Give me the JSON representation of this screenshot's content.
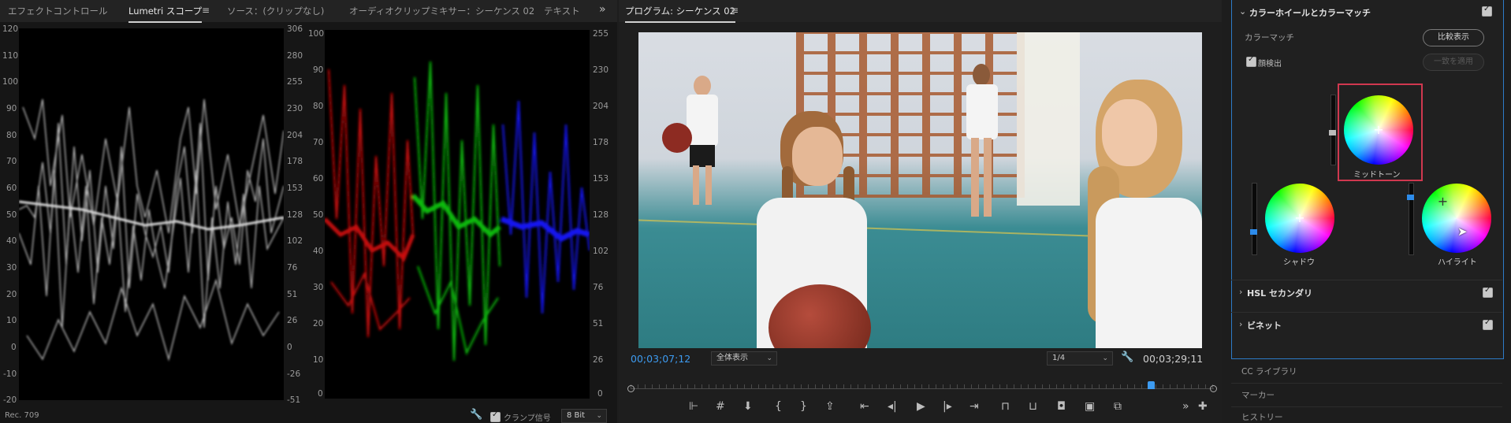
{
  "left_panel": {
    "tabs": [
      "エフェクトコントロール",
      "Lumetri スコープ",
      "ソース：(クリップなし)",
      "オーディオクリップミキサー：シーケンス 02",
      "テキスト"
    ],
    "active_tab": "Lumetri スコープ",
    "waveform": {
      "left_axis": [
        "120",
        "110",
        "100",
        "90",
        "80",
        "70",
        "60",
        "50",
        "40",
        "30",
        "20",
        "10",
        "0",
        "-10",
        "-20"
      ],
      "right_axis": [
        "306",
        "280",
        "255",
        "230",
        "204",
        "178",
        "153",
        "128",
        "102",
        "76",
        "51",
        "26",
        "0",
        "-26",
        "-51"
      ]
    },
    "parade": {
      "left_axis": [
        "100",
        "90",
        "80",
        "70",
        "60",
        "50",
        "40",
        "30",
        "20",
        "10",
        "0"
      ],
      "right_axis": [
        "255",
        "230",
        "204",
        "178",
        "153",
        "128",
        "102",
        "76",
        "51",
        "26",
        "0"
      ]
    },
    "footer": {
      "color_space": "Rec. 709",
      "clamp_label": "クランプ信号",
      "bit_depth": "8 Bit"
    }
  },
  "program": {
    "title": "プログラム: シーケンス 02",
    "timecode_current": "00;03;07;12",
    "fit_label": "全体表示",
    "resolution": "1/4",
    "timecode_duration": "00;03;29;11",
    "playhead_fraction": 0.892
  },
  "right_panel": {
    "section_title": "カラーホイールとカラーマッチ",
    "color_match_label": "カラーマッチ",
    "compare_button": "比較表示",
    "face_detect_label": "顔検出",
    "apply_match_button": "一致を適用",
    "wheels": {
      "midtone": "ミッドトーン",
      "shadow": "シャドウ",
      "highlight": "ハイライト"
    },
    "sections": [
      "HSL セカンダリ",
      "ビネット"
    ],
    "lower_panels": [
      "CC ライブラリ",
      "マーカー",
      "ヒストリー"
    ]
  },
  "colors": {
    "accent_blue": "#2d8ceb",
    "highlight_border": "#d0384f",
    "timecode_blue": "#3d9bf0"
  }
}
